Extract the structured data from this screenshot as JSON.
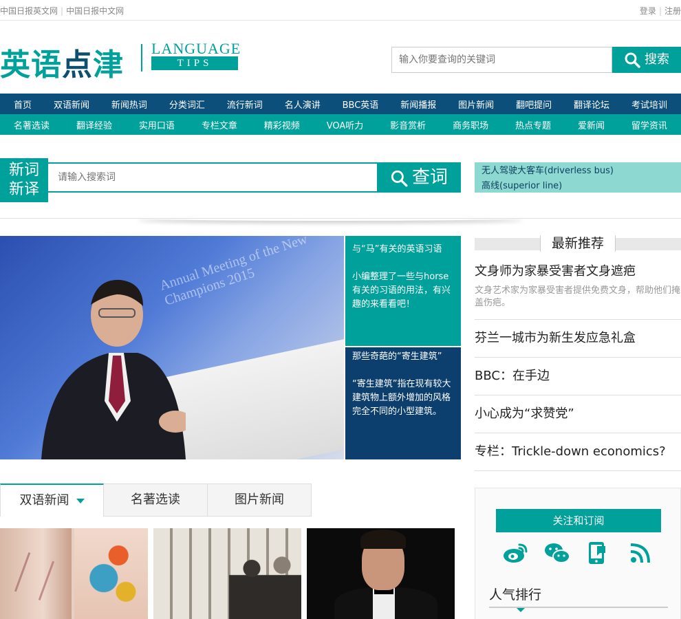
{
  "topbar": {
    "link_en": "中国日报英文网",
    "link_cn": "中国日报中文网",
    "login": "登录",
    "register": "注册"
  },
  "logo": {
    "cn_part1": "英语",
    "cn_part2": "点",
    "cn_part3": "津",
    "en_line1": "LANGUAGE",
    "en_line2": "TIPS"
  },
  "header_search": {
    "placeholder": "输入你要查询的关键词",
    "button": "搜索"
  },
  "nav_primary": [
    "首页",
    "双语新闻",
    "新闻热词",
    "分类词汇",
    "流行新词",
    "名人演讲",
    "BBC英语",
    "新闻播报",
    "图片新闻",
    "翻吧提问",
    "翻译论坛",
    "考试培训"
  ],
  "nav_secondary": [
    "名著选读",
    "翻译经验",
    "实用口语",
    "专栏文章",
    "精彩视频",
    "VOA听力",
    "影音赏析",
    "商务职场",
    "热点专题",
    "爱新闻",
    "留学资讯"
  ],
  "new_words": {
    "tag_line1": "新词",
    "tag_line2": "新译",
    "placeholder": "请输入搜索词",
    "button": "查词",
    "hot": [
      "无人驾驶大客车(driverless bus)",
      "高线(superior line)"
    ]
  },
  "hero": {
    "banner_text": "Annual Meeting of the New Champions 2015",
    "card1_title": "与“马”有关的英语习语",
    "card1_desc": "小编整理了一些与horse有关的习语的用法，有兴趣的来看看吧！",
    "card2_title": "那些奇葩的“寄生建筑”",
    "card2_desc": "“寄生建筑”指在现有较大建筑物上额外增加的风格完全不同的小型建筑。"
  },
  "recommend": {
    "title": "最新推荐",
    "lead_title": "文身师为家暴受害者文身遮疤",
    "lead_desc": "文身艺术家为家暴受害者提供免费文身，帮助他们掩盖伤疤。",
    "items": [
      "芬兰一城市为新生发应急礼盒",
      "BBC：在手边",
      "小心成为“求赞党”",
      "专栏：Trickle-down economics?"
    ]
  },
  "follow": {
    "button": "关注和订阅",
    "icons": [
      "weibo-icon",
      "wechat-icon",
      "mobile-icon",
      "rss-icon"
    ],
    "rank_title": "人气排行"
  },
  "tabs": [
    "双语新闻",
    "名著选读",
    "图片新闻"
  ],
  "colors": {
    "teal": "#00a19a",
    "navy": "#0c4f7a",
    "dark_navy": "#0c3f6e",
    "light_teal": "#8ed8d2"
  }
}
